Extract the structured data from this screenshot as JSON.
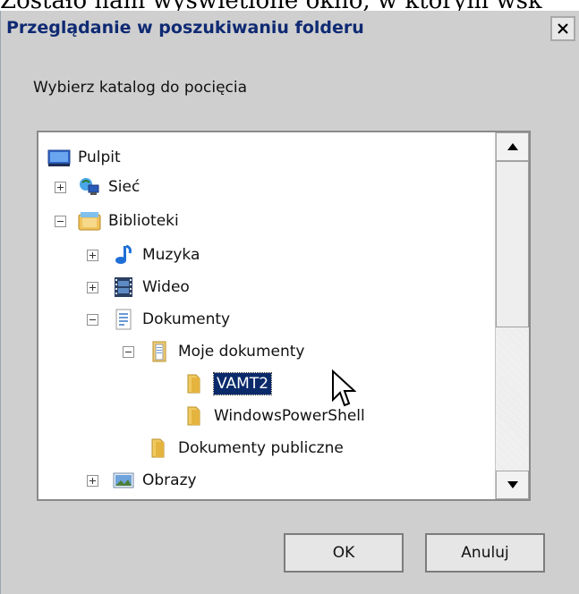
{
  "background_text": "Zostało nam wyświetlone okno, w którym wsk",
  "dialog": {
    "title": "Przeglądanie w poszukiwaniu folderu",
    "close_glyph": "X",
    "prompt": "Wybierz katalog do pocięcia",
    "buttons": {
      "ok": "OK",
      "cancel": "Anuluj"
    }
  },
  "tree": {
    "items": [
      {
        "label": "Pulpit",
        "icon": "desktop-icon",
        "expander": "none",
        "selected": false
      },
      {
        "label": "Sieć",
        "icon": "network-icon",
        "expander": "plus",
        "selected": false
      },
      {
        "label": "Biblioteki",
        "icon": "libraries-icon",
        "expander": "minus",
        "selected": false
      },
      {
        "label": "Muzyka",
        "icon": "music-icon",
        "expander": "plus",
        "selected": false
      },
      {
        "label": "Wideo",
        "icon": "video-icon",
        "expander": "plus",
        "selected": false
      },
      {
        "label": "Dokumenty",
        "icon": "documents-icon",
        "expander": "minus",
        "selected": false
      },
      {
        "label": "Moje dokumenty",
        "icon": "folder-icon",
        "expander": "minus",
        "selected": false
      },
      {
        "label": "VAMT2",
        "icon": "folder-icon",
        "expander": "none",
        "selected": true
      },
      {
        "label": "WindowsPowerShell",
        "icon": "folder-icon",
        "expander": "none",
        "selected": false
      },
      {
        "label": "Dokumenty publiczne",
        "icon": "folder-icon",
        "expander": "none",
        "selected": false
      },
      {
        "label": "Obrazy",
        "icon": "pictures-icon",
        "expander": "plus",
        "selected": false
      }
    ]
  },
  "colors": {
    "title_text": "#0f2a73",
    "selection_bg": "#0a2a6a"
  }
}
